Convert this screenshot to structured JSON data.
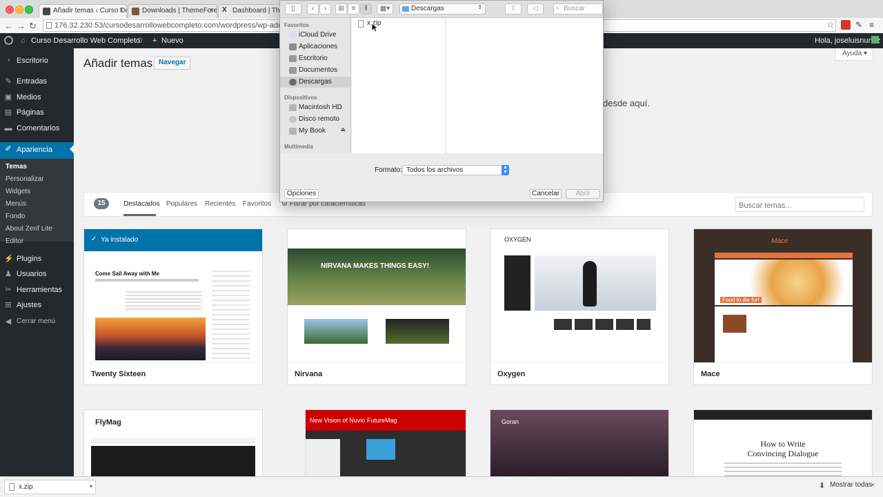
{
  "browser": {
    "tabs": [
      {
        "title": "Añadir temas ‹ Curso Desa"
      },
      {
        "title": "Downloads | ThemeForest"
      },
      {
        "title": "Dashboard | Themefo"
      }
    ],
    "url": "176.32.230.53/cursodesarrollowebcompleto.com/wordpress/wp-admin/the"
  },
  "adminbar": {
    "site_name": "Curso Desarrollo Web Completo",
    "comments_count": "0",
    "new_label": "Nuevo",
    "greeting": "Hola, joseluisnunez"
  },
  "sidebar": {
    "items": [
      {
        "label": "Escritorio",
        "icon": "dashboard-icon"
      },
      {
        "label": "Entradas",
        "icon": "pin-icon"
      },
      {
        "label": "Medios",
        "icon": "media-icon"
      },
      {
        "label": "Páginas",
        "icon": "pages-icon"
      },
      {
        "label": "Comentarios",
        "icon": "comment-icon"
      },
      {
        "label": "Apariencia",
        "icon": "brush-icon"
      },
      {
        "label": "Plugins",
        "icon": "plugin-icon"
      },
      {
        "label": "Usuarios",
        "icon": "users-icon"
      },
      {
        "label": "Herramientas",
        "icon": "tools-icon"
      },
      {
        "label": "Ajustes",
        "icon": "settings-icon"
      },
      {
        "label": "Cerrar menú",
        "icon": "collapse-icon"
      }
    ],
    "submenu": [
      "Temas",
      "Personalizar",
      "Widgets",
      "Menús",
      "Fondo",
      "About Zerif Lite",
      "Editor"
    ]
  },
  "main": {
    "title": "Añadir temas",
    "browse_button": "Navegar",
    "help": "Ayuda",
    "upload_hint": "desde aquí.",
    "theme_count": "15",
    "filter_tabs": [
      "Destacados",
      "Populares",
      "Recientes",
      "Favoritos"
    ],
    "feature_filter": "Filtrar por características",
    "search_placeholder": "Buscar temas...",
    "installed_label": "Ya instalado",
    "themes": [
      {
        "name": "Twenty Sixteen",
        "headline": "Come Sail Away with Me"
      },
      {
        "name": "Nirvana",
        "headline": "NIRVANA MAKES THINGS EASY!"
      },
      {
        "name": "Oxygen",
        "headline": "OXYGEN"
      },
      {
        "name": "Mace",
        "headline": "Food to die for!"
      },
      {
        "name": "",
        "headline": "FlyMag"
      },
      {
        "name": "",
        "headline": "New Vision of Nuvio FutureMag"
      },
      {
        "name": "",
        "headline": "Goran"
      },
      {
        "name": "",
        "headline": "How to Write Convincing Dialogue"
      }
    ]
  },
  "dialog": {
    "location": "Descargas",
    "search_placeholder": "Buscar",
    "favorites_heading": "Favoritos",
    "favorites": [
      "iCloud Drive",
      "Aplicaciones",
      "Escritorio",
      "Documentos",
      "Descargas"
    ],
    "devices_heading": "Dispositivos",
    "devices": [
      "Macintosh HD",
      "Disco remoto",
      "My Book"
    ],
    "media_heading": "Multimedia",
    "file": "x.zip",
    "format_label": "Formato:",
    "format_value": "Todos los archivos",
    "options_button": "Opciones",
    "cancel_button": "Cancelar",
    "open_button": "Abrir"
  },
  "downloads": {
    "item": "x.zip",
    "show_all": "Mostrar todas"
  },
  "colors": {
    "wp_blue": "#0073aa",
    "admin_dark": "#23282d"
  }
}
